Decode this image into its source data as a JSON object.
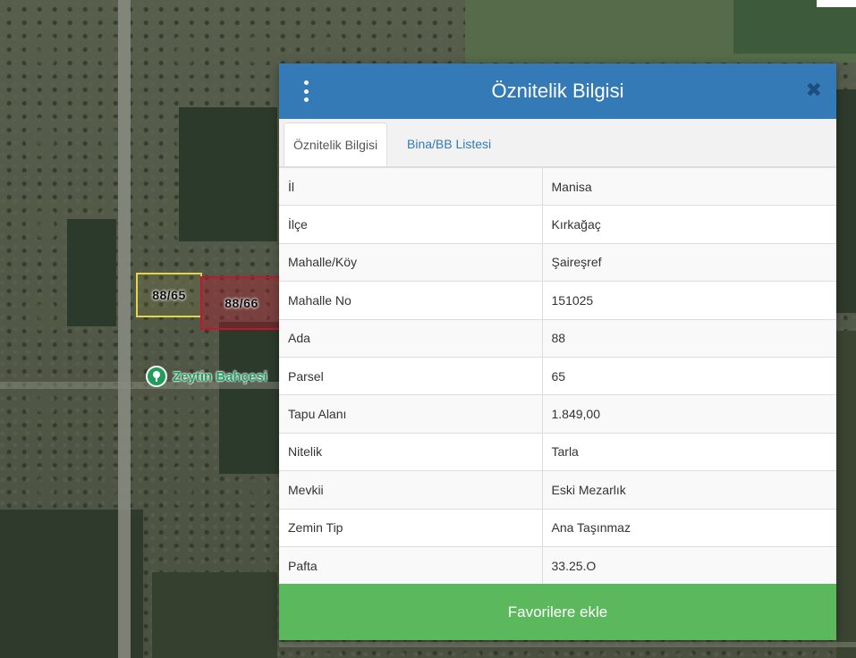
{
  "map": {
    "parcels": [
      {
        "label": "88/65",
        "color": "#e8d24a"
      },
      {
        "label": "88/66",
        "color": "#c2162e"
      }
    ],
    "poi": {
      "label": "Zeytin Bahçesi",
      "icon": "tree-icon",
      "color": "#1e9e5a"
    }
  },
  "dialog": {
    "title": "Öznitelik Bilgisi",
    "menu_icon": "vertical-dots-icon",
    "close_icon": "close-icon",
    "tabs": [
      {
        "label": "Öznitelik Bilgisi",
        "active": true
      },
      {
        "label": "Bina/BB Listesi",
        "active": false
      }
    ],
    "rows": [
      {
        "key": "İl",
        "value": "Manisa"
      },
      {
        "key": "İlçe",
        "value": "Kırkağaç"
      },
      {
        "key": "Mahalle/Köy",
        "value": "Şaireşref"
      },
      {
        "key": "Mahalle No",
        "value": "151025"
      },
      {
        "key": "Ada",
        "value": "88"
      },
      {
        "key": "Parsel",
        "value": "65"
      },
      {
        "key": "Tapu Alanı",
        "value": "1.849,00"
      },
      {
        "key": "Nitelik",
        "value": "Tarla"
      },
      {
        "key": "Mevkii",
        "value": "Eski Mezarlık"
      },
      {
        "key": "Zemin Tip",
        "value": "Ana Taşınmaz"
      },
      {
        "key": "Pafta",
        "value": "33.25.O"
      }
    ],
    "favorite_button": "Favorilere ekle",
    "colors": {
      "header": "#337ab7",
      "button": "#5cb85c"
    }
  }
}
